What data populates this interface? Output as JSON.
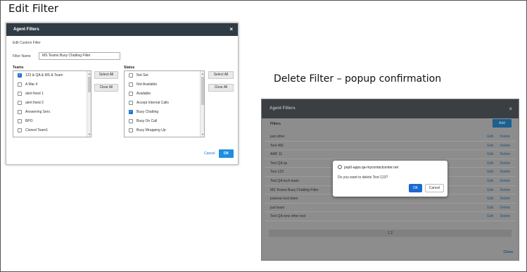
{
  "captions": {
    "edit": "Edit Filter",
    "delete": "Delete Filter – popup confirmation"
  },
  "edit_dialog": {
    "title": "Agent Filters",
    "close": "×",
    "subtitle": "Edit Custom Filter",
    "filter_name_label": "Filter Name",
    "filter_name_value": "MS Teams Busy Chatting Filter",
    "teams": {
      "label": "Teams",
      "select_all": "Select All",
      "clear_all": "Clear All",
      "items": [
        {
          "label": "123 & QA & MS & Team",
          "checked": true
        },
        {
          "label": "A Mar 4",
          "checked": false
        },
        {
          "label": "alert fixed 1",
          "checked": false
        },
        {
          "label": "alert fixed 2",
          "checked": false
        },
        {
          "label": "Answering Serv.",
          "checked": false
        },
        {
          "label": "BPO",
          "checked": false
        },
        {
          "label": "Cloned Team1",
          "checked": false
        }
      ]
    },
    "status": {
      "label": "Status",
      "select_all": "Select All",
      "clear_all": "Clear All",
      "items": [
        {
          "label": "Not Set",
          "checked": false
        },
        {
          "label": "Not Available",
          "checked": false
        },
        {
          "label": "Available",
          "checked": false
        },
        {
          "label": "Accept Internal Calls",
          "checked": false
        },
        {
          "label": "Busy Chatting",
          "checked": true
        },
        {
          "label": "Busy On Call",
          "checked": false
        },
        {
          "label": "Busy Wrapping Up",
          "checked": false
        }
      ]
    },
    "cancel": "Cancel",
    "ok": "OK"
  },
  "delete_dialog": {
    "title": "Agent Filters",
    "close": "×",
    "filters_label": "Filters",
    "add": "Add",
    "rows": [
      "just other",
      "Test 456",
      "AMF 11",
      "Test QA qx",
      "Test 123",
      "Test QA tech team",
      "MS Teams Busy Chatting Filter",
      "joannas test team",
      "just team",
      "Test QA new other test"
    ],
    "edit_label": "Edit",
    "delete_label": "Delete",
    "pager": "1 2",
    "close_link": "Close"
  },
  "popup": {
    "site": "pop0-apps.qa-mycontactcenter.net",
    "message": "Do you want to delete Test 123?",
    "ok": "OK",
    "cancel": "Cancel"
  }
}
